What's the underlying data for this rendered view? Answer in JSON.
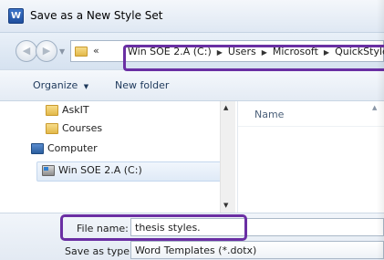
{
  "window": {
    "title": "Save as a New Style Set",
    "app_icon": "word-document-icon"
  },
  "address_bar": {
    "overflow_glyph": "«",
    "path": [
      "Win SOE 2.A (C:)",
      "Users",
      "Microsoft",
      "QuickStyle"
    ]
  },
  "toolbar": {
    "organize_label": "Organize",
    "new_folder_label": "New folder"
  },
  "navigation": {
    "items": [
      {
        "label": "AskIT",
        "icon": "folder-icon"
      },
      {
        "label": "Courses",
        "icon": "folder-icon"
      },
      {
        "label": "Computer",
        "icon": "computer-icon"
      },
      {
        "label": "Win SOE 2.A (C:)",
        "icon": "drive-icon",
        "selected": true
      }
    ]
  },
  "content": {
    "column_header": "Name"
  },
  "form": {
    "file_name_label": "File name:",
    "file_name_value": "thesis styles.",
    "save_as_type_label": "Save as type:",
    "save_as_type_value": "Word Templates (*.dotx)"
  },
  "colors": {
    "highlight": "#6a2fa3",
    "title_gradient_top": "#f4f7fb",
    "title_gradient_bottom": "#dfe8f3"
  }
}
